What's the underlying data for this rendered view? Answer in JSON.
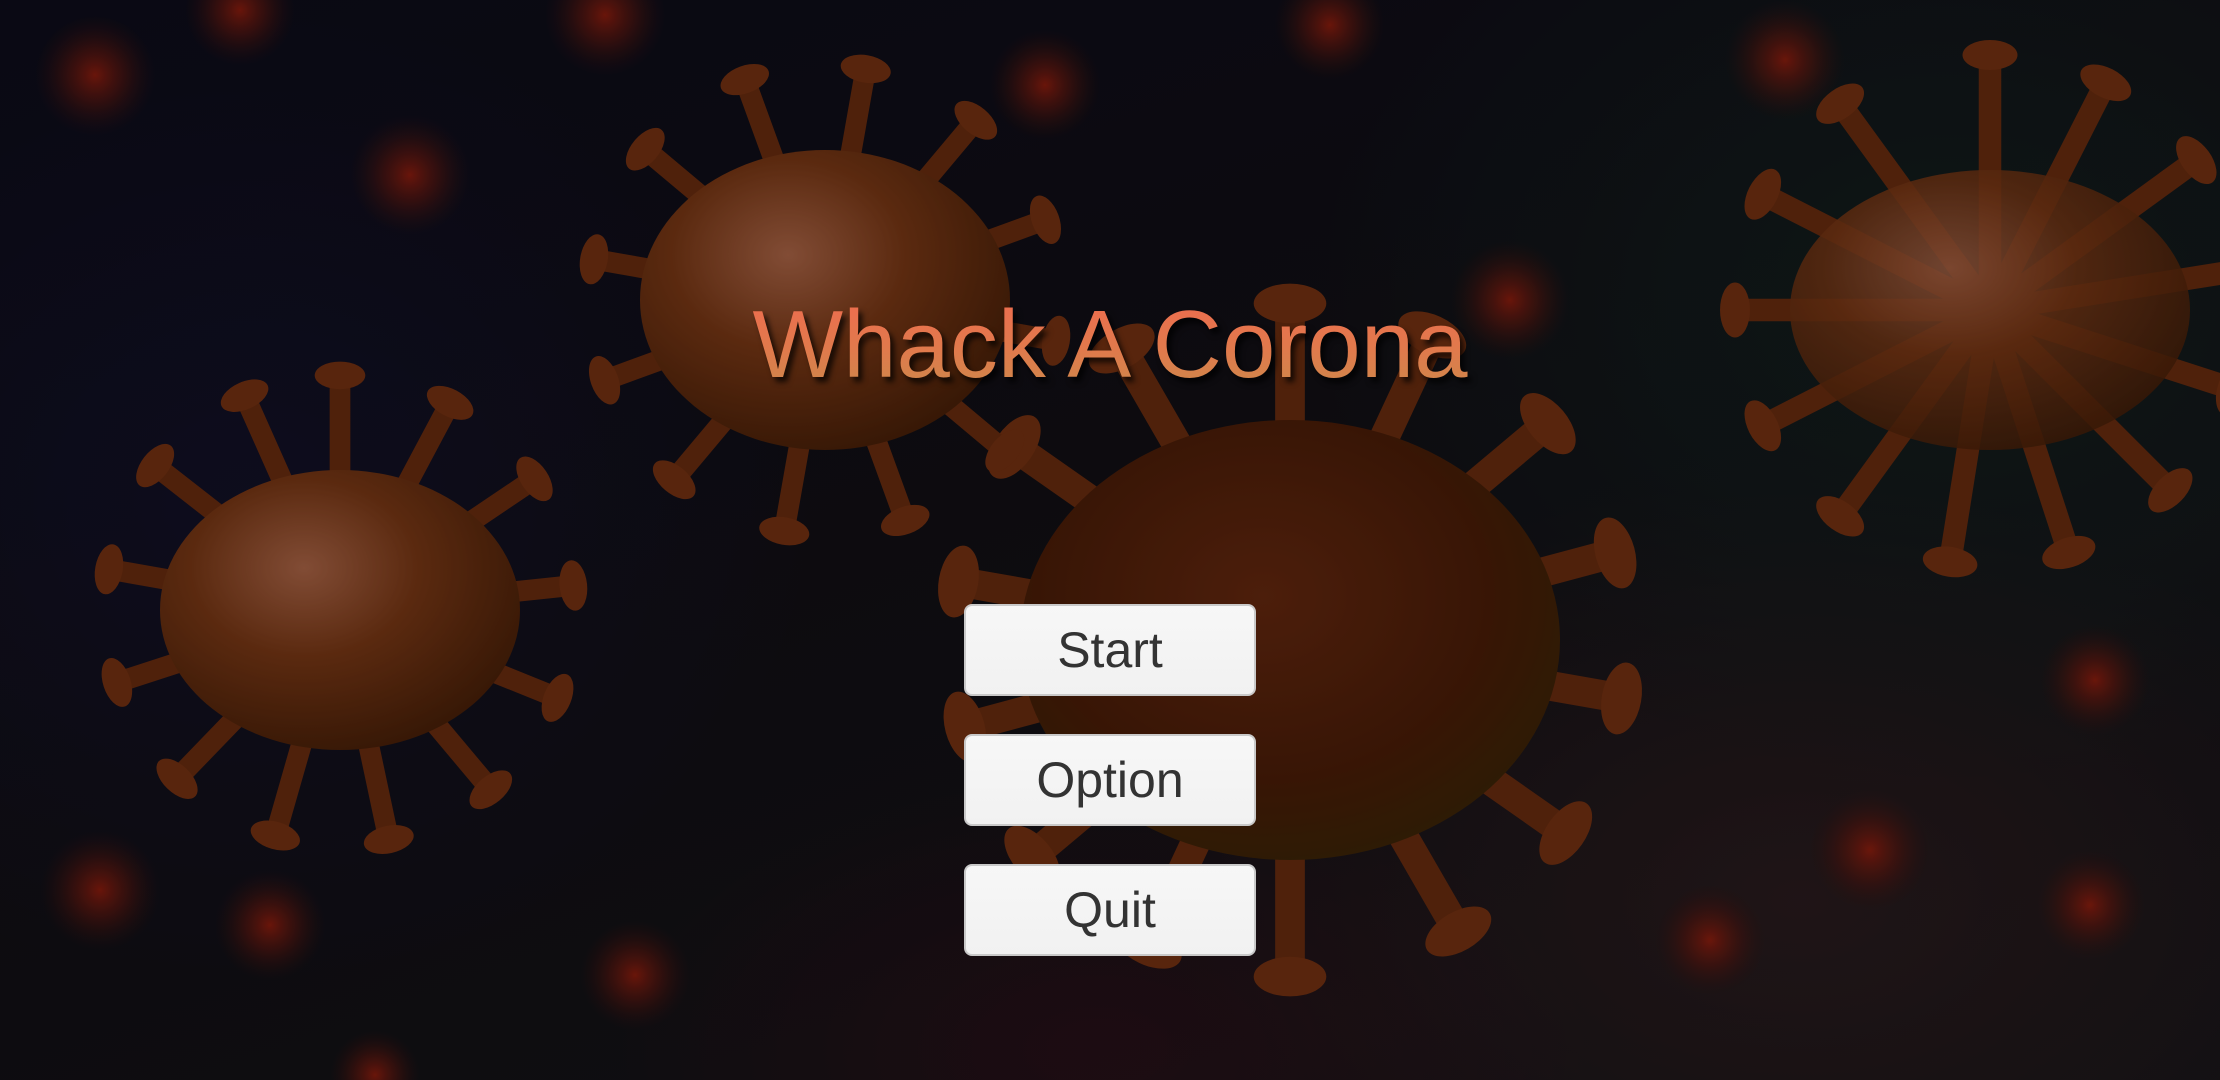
{
  "game": {
    "title": "Whack A Corona"
  },
  "menu": {
    "buttons": [
      {
        "label": "Start"
      },
      {
        "label": "Option"
      },
      {
        "label": "Quit"
      }
    ]
  },
  "theme": {
    "title_color_top": "#f06a4f",
    "title_color_bottom": "#c98a4a",
    "button_bg": "#f4f4f4",
    "button_text": "#333333",
    "virus_color": "#8a3a12"
  },
  "icons": [
    "virus-icon"
  ]
}
